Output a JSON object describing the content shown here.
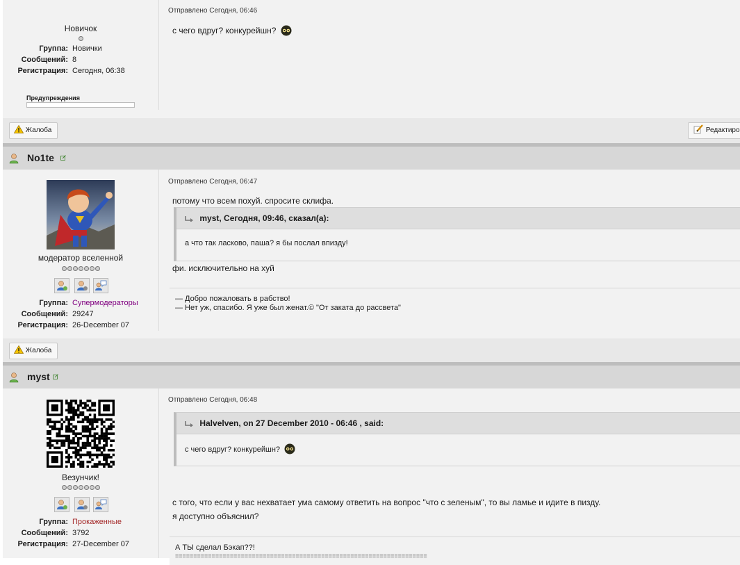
{
  "post1": {
    "rank": "Новичок",
    "group_label": "Группа:",
    "group_value": "Новички",
    "posts_label": "Сообщений:",
    "posts_value": "8",
    "reg_label": "Регистрация:",
    "reg_value": "Сегодня, 06:38",
    "warnings_label": "Предупреждения",
    "posted": "Отправлено Сегодня, 06:46",
    "text": "с чего вдруг? конкурейшн?",
    "report_label": "Жалоба",
    "edit_label": "Редактировать"
  },
  "post2": {
    "author": "No1te",
    "rank": "модератор вселенной",
    "group_label": "Группа:",
    "group_value": "Супермодераторы",
    "group_color": "#800080",
    "posts_label": "Сообщений:",
    "posts_value": "29247",
    "reg_label": "Регистрация:",
    "reg_value": "26-December 07",
    "posted": "Отправлено Сегодня, 06:47",
    "text_before": "потому что всем похуй. спросите склифа.",
    "quote_head": "myst, Сегодня, 09:46, сказал(а):",
    "quote_body": "а что так ласково, паша? я бы послал впизду!",
    "text_after": "фи. исключительно на хуй",
    "sig_line1": "— Добро пожаловать в рабство!",
    "sig_line2": "— Нет уж, спасибо. Я уже был женат.© \"От заката до рассвета\"",
    "report_label": "Жалоба"
  },
  "post3": {
    "author": "myst",
    "rank": "Везунчик!",
    "group_label": "Группа:",
    "group_value": "Прокаженные",
    "group_color": "#a52a2a",
    "posts_label": "Сообщений:",
    "posts_value": "3792",
    "reg_label": "Регистрация:",
    "reg_value": "27-December 07",
    "posted": "Отправлено Сегодня, 06:48",
    "quote_head": "Halvelven, on 27 December 2010 - 06:46 , said:",
    "quote_body": "с чего вдруг? конкурейшн?",
    "text_line1": "с того, что если у вас нехватает ума самому ответить на вопрос \"что с зеленым\", то вы ламье и идите в пизду.",
    "text_line2": "я доступно объяснил?",
    "sig_line1": "А ТЫ сделал Бэкап??!",
    "sig_line2": "====================================================================="
  }
}
